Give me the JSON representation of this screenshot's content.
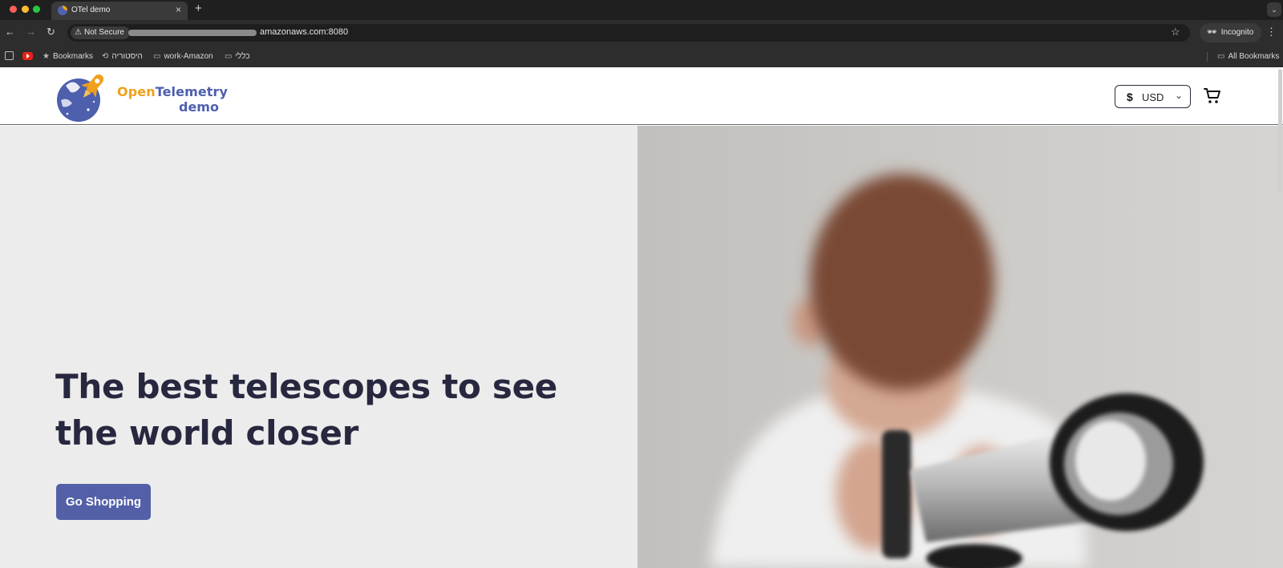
{
  "browser": {
    "tab_title": "OTel demo",
    "tab_close": "×",
    "new_tab": "+",
    "security_label": "Not Secure",
    "url_visible": "amazonaws.com:8080",
    "incognito_label": "Incognito",
    "bookmarks": {
      "bookmarks_label": "Bookmarks",
      "history_label": "היסטוריה",
      "work_folder": "work-Amazon",
      "general_folder": "כללי",
      "all_bookmarks": "All Bookmarks"
    }
  },
  "header": {
    "logo_open": "Open",
    "logo_telemetry": "Telemetry",
    "logo_demo": "demo",
    "currency_symbol": "$",
    "currency_code": "USD"
  },
  "hero": {
    "title": "The best telescopes to see the world closer",
    "cta_label": "Go Shopping"
  },
  "colors": {
    "brand_blue": "#4d5fad",
    "brand_orange": "#f0a01c",
    "cta_bg": "#5360a8",
    "hero_left_bg": "#ececec",
    "title_color": "#27283f"
  },
  "icons": [
    "warning-icon",
    "star-icon",
    "incognito-icon",
    "cart-icon",
    "chevron-down-icon",
    "folder-icon",
    "history-icon"
  ]
}
